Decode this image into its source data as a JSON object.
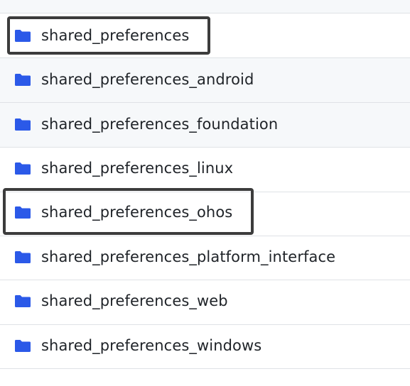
{
  "file_list": {
    "icon": "folder-icon",
    "icon_color": "#2b59e8",
    "highlight_color": "#3c3c3c",
    "items": [
      {
        "name": "shared_preferences",
        "highlighted": true
      },
      {
        "name": "shared_preferences_android",
        "highlighted": false
      },
      {
        "name": "shared_preferences_foundation",
        "highlighted": false
      },
      {
        "name": "shared_preferences_linux",
        "highlighted": false
      },
      {
        "name": "shared_preferences_ohos",
        "highlighted": true
      },
      {
        "name": "shared_preferences_platform_interface",
        "highlighted": false
      },
      {
        "name": "shared_preferences_web",
        "highlighted": false
      },
      {
        "name": "shared_preferences_windows",
        "highlighted": false
      }
    ]
  }
}
